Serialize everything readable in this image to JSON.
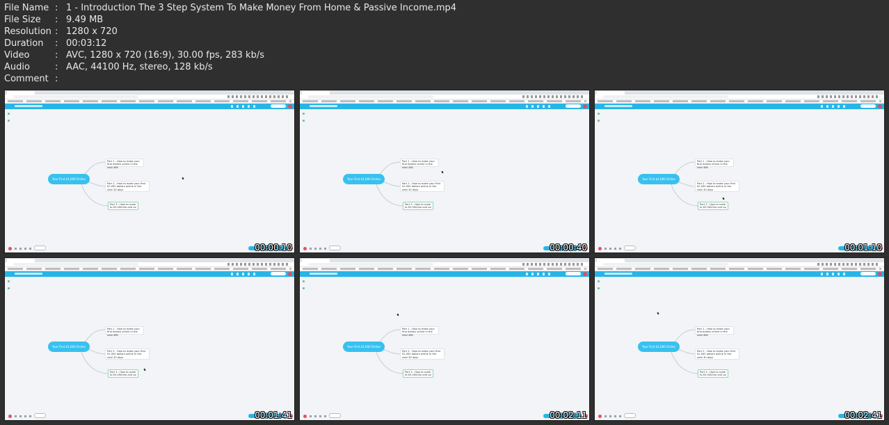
{
  "file_info": [
    {
      "key": "File Name",
      "sep": ":",
      "value": "1 - Introduction The 3 Step System To Make Money From Home & Passive Income.mp4"
    },
    {
      "key": "File Size",
      "sep": ":",
      "value": "9.49 MB"
    },
    {
      "key": "Resolution",
      "sep": ":",
      "value": "1280 x 720"
    },
    {
      "key": "Duration",
      "sep": ":",
      "value": "00:03:12"
    },
    {
      "key": "Video",
      "sep": ":",
      "value": "AVC, 1280 x 720 (16:9), 30.00 fps, 283 kb/s"
    },
    {
      "key": "Audio",
      "sep": ":",
      "value": "AAC, 44100 Hz, stereo, 128 kb/s"
    },
    {
      "key": "Comment",
      "sep": ":",
      "value": ""
    }
  ],
  "mindmap": {
    "root": "Your First $1,000 Online",
    "part1": "Part 1 - How to make your first dollars online in the next 48h",
    "part2": "Part 2 - How to make your first $1,000 dollars online in the next 30 days",
    "part3": "Part 3 - How to scale to $5,000/mo and up"
  },
  "thumbnails": [
    {
      "timestamp": "00:00:10"
    },
    {
      "timestamp": "00:00:40"
    },
    {
      "timestamp": "00:01:10"
    },
    {
      "timestamp": "00:01:41"
    },
    {
      "timestamp": "00:02:11"
    },
    {
      "timestamp": "00:02:41"
    }
  ],
  "colors": {
    "background": "#2f2f2f",
    "app_accent": "#27b5e8",
    "root_node": "#38c1ef",
    "canvas": "#f2f4f7"
  }
}
